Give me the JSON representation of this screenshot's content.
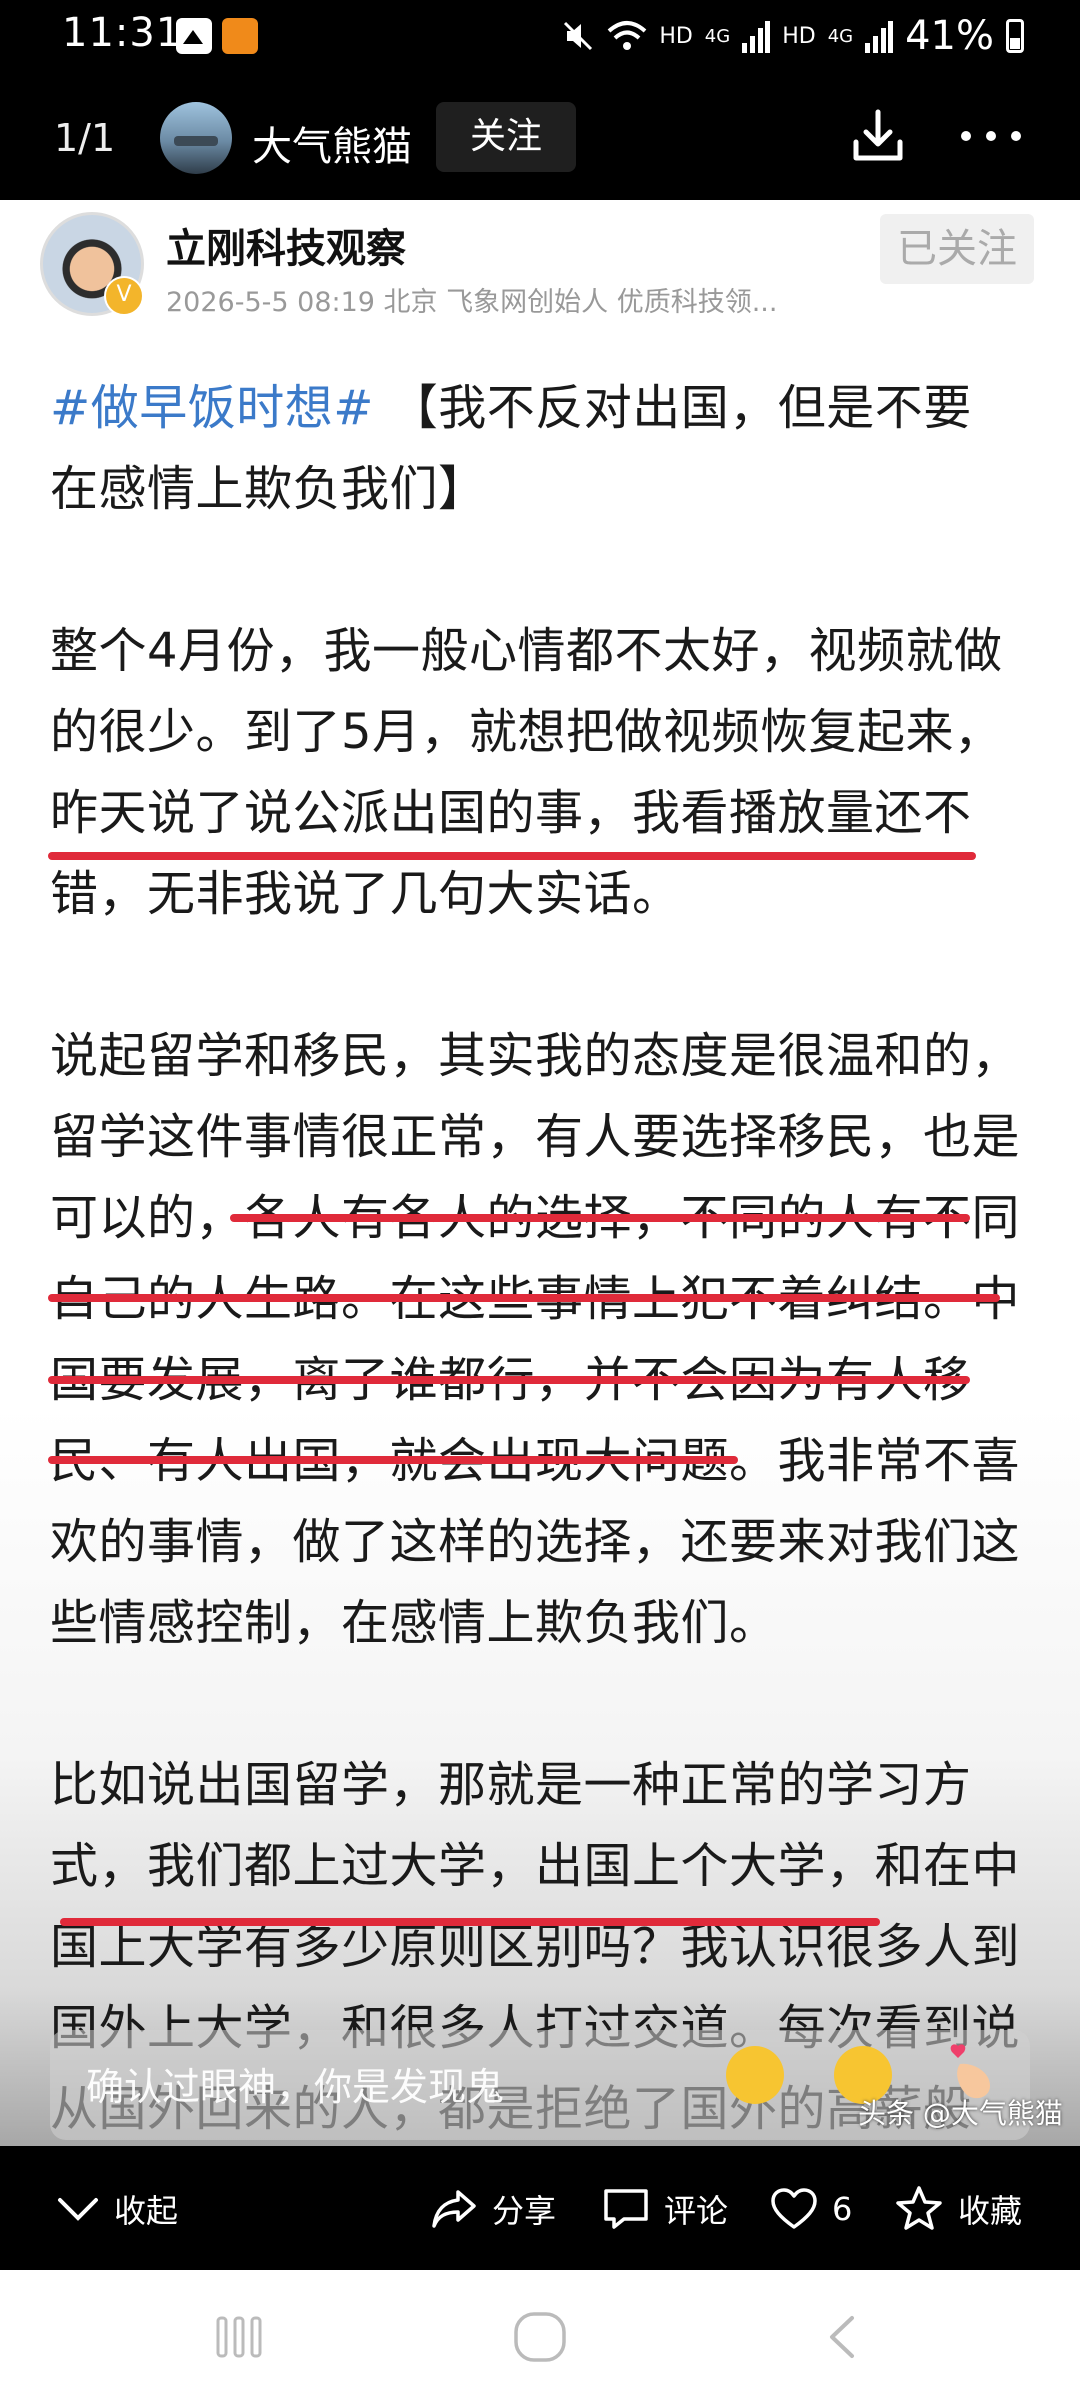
{
  "status_bar": {
    "time": "11:31",
    "network_1": "HD",
    "signal_1": "4G",
    "network_2": "HD",
    "signal_2": "4G",
    "battery": "41%",
    "icons": [
      "image-icon",
      "app-notification-icon",
      "mute-icon",
      "wifi-icon",
      "signal-icon",
      "battery-icon"
    ]
  },
  "header": {
    "page_counter": "1/1",
    "author_name": "大气熊猫",
    "follow_label": "关注"
  },
  "post": {
    "poster_name": "立刚科技观察",
    "meta": "2026-5-5 08:19 北京 飞象网创始人 优质科技领...",
    "followed_label": "已关注",
    "avatar_badge": "V",
    "hashtag": "#做早饭时想#",
    "paragraphs": [
      " 【我不反对出国，但是不要在感情上欺负我们】",
      "整个4月份，我一般心情都不太好，视频就做的很少。到了5月，就想把做视频恢复起来，昨天说了说公派出国的事，我看播放量还不错，无非我说了几句大实话。",
      "说起留学和移民，其实我的态度是很温和的，留学这件事情很正常，有人要选择移民，也是可以的，各人有各人的选择，不同的人有不同自己的人生路。在这些事情上犯不着纠结。中国要发展，离了谁都行，并不会因为有人移民、有人出国，就会出现大问题。我非常不喜欢的事情，做了这样的选择，还要来对我们这些情感控制，在感情上欺负我们。",
      "比如说出国留学，那就是一种正常的学习方式，我们都上过大学，出国上个大学，和在中国上大学有多少原则区别吗？我认识很多人到国外上大学，和很多人打过交道。每次看到说从国外回来的人，都是拒绝了国外的高薪般"
    ],
    "overlay_comment": "确认过眼神，你是发现鬼",
    "watermark": "头条 @大气熊猫",
    "accent_color": "#3b7ac9",
    "underline_color": "#e02a3a"
  },
  "actions": {
    "collapse": "收起",
    "share": "分享",
    "comment": "评论",
    "like_count": "6",
    "favorite": "收藏"
  }
}
